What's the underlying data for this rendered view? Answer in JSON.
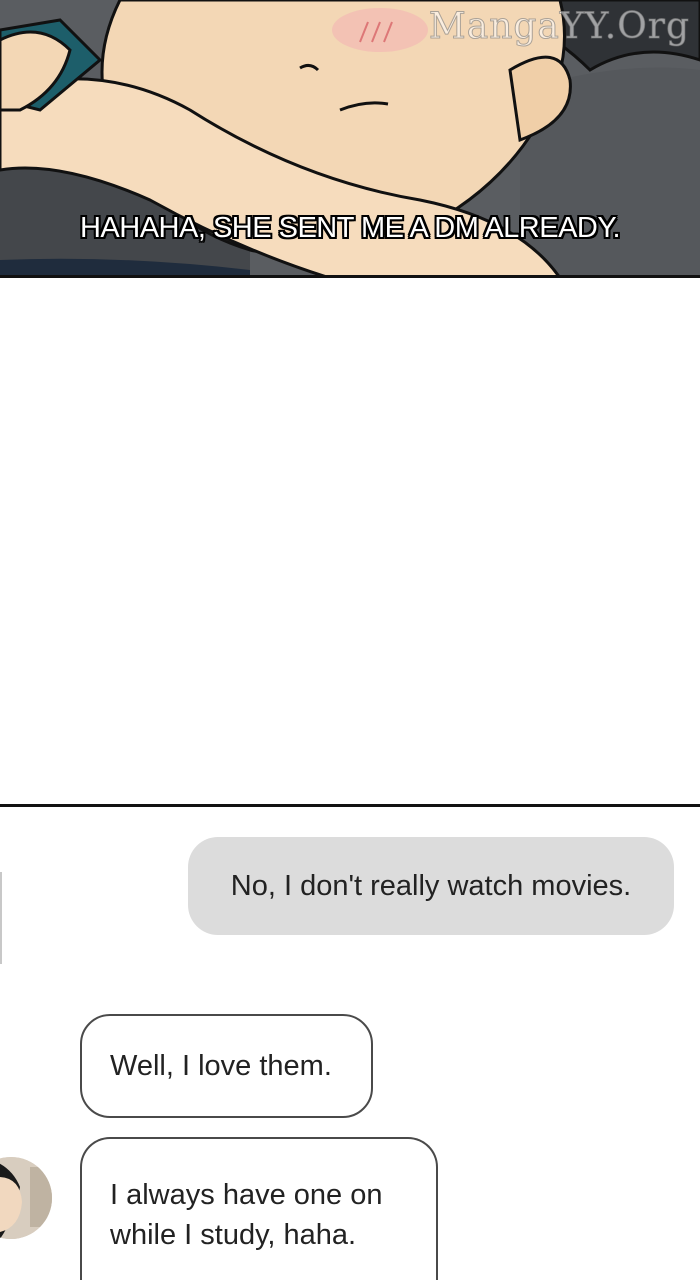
{
  "watermark": "MangaYY.Org",
  "panel_caption": "HAHAHA, SHE SENT ME A DM ALREADY.",
  "chat": {
    "sent_message": "No, I don't really watch movies.",
    "received_messages": [
      "Well, I love them.",
      "I always have one on while I study, haha."
    ]
  },
  "colors": {
    "sent_bubble": "#dcdcdc",
    "received_bubble_border": "#4a4a4a",
    "skin": "#f3d7b5",
    "background_gray": "#4b4e52"
  }
}
